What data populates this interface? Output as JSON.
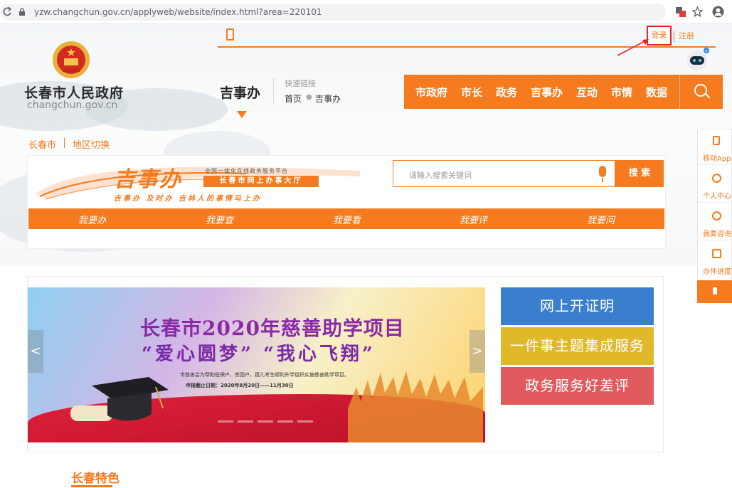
{
  "browser": {
    "url": "yzw.changchun.gov.cn/applyweb/website/index.html?area=220101"
  },
  "header": {
    "login_label": "登录",
    "register_label": "注册",
    "site_title": "长春市人民政府",
    "site_domain": "changchun.gov.cn",
    "section_name": "吉事办",
    "quick_links_label": "快速链接",
    "breadcrumb": [
      "首页",
      "吉事办"
    ]
  },
  "main_nav": [
    "市政府",
    "市长",
    "政务",
    "吉事办",
    "互动",
    "市情",
    "数据"
  ],
  "city_bar": {
    "city": "长春市",
    "switch_label": "地区切换"
  },
  "jishiban_banner": {
    "main_title": "吉事办",
    "top_line": "全国一体化在线政务服务平台",
    "hall_name": "长春市网上办事大厅",
    "slogan": "吉事办 及时办 吉林人的事情马上办"
  },
  "search": {
    "placeholder": "请输入搜索关键词",
    "button_label": "搜 索"
  },
  "actions": [
    "我要办",
    "我要查",
    "我要看",
    "我要评",
    "我要问"
  ],
  "sidebar": [
    {
      "label": "移动App",
      "icon": "phone-icon"
    },
    {
      "label": "个人中心",
      "icon": "user-icon"
    },
    {
      "label": "我要咨询",
      "icon": "chat-icon"
    },
    {
      "label": "办件进度",
      "icon": "edit-icon"
    }
  ],
  "carousel": {
    "title": "长春市2020年慈善助学项目",
    "subtitle": "“爱心圆梦” “我心飞翔”",
    "description": "市慈善会为帮助低保户、贫困户、孤儿考生顺利升学组织实施慈善助学项目。",
    "deadline": "申报截止日期：2020年8月20日——11月30日",
    "prev_label": "<",
    "next_label": ">"
  },
  "service_buttons": [
    {
      "label": "网上开证明",
      "color": "#3a7fce"
    },
    {
      "label": "一件事主题集成服务",
      "color": "#e0b92a"
    },
    {
      "label": "政务服务好差评",
      "color": "#e05a5e"
    }
  ],
  "featured": {
    "title": "长春特色"
  },
  "colors": {
    "accent": "#f57b1e",
    "login_highlight": "#e32424"
  }
}
